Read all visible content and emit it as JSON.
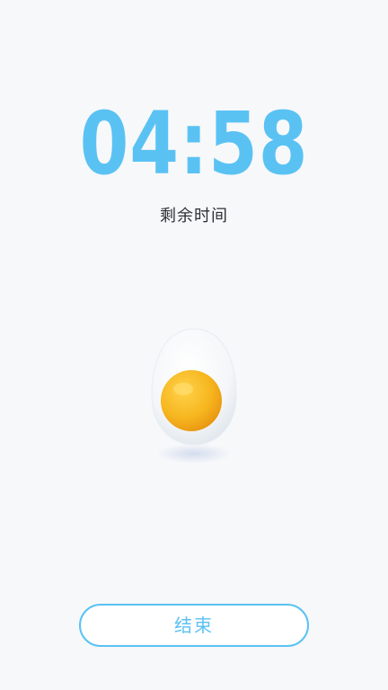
{
  "timer": {
    "remaining": "04:58",
    "label": "剩余时间"
  },
  "egg": {
    "icon": "fried-egg-icon"
  },
  "actions": {
    "end_label": "结束"
  },
  "colors": {
    "accent": "#5ac2f3",
    "background": "#f7f8fa",
    "text": "#2d2f33",
    "yolk": "#f6b51e"
  }
}
